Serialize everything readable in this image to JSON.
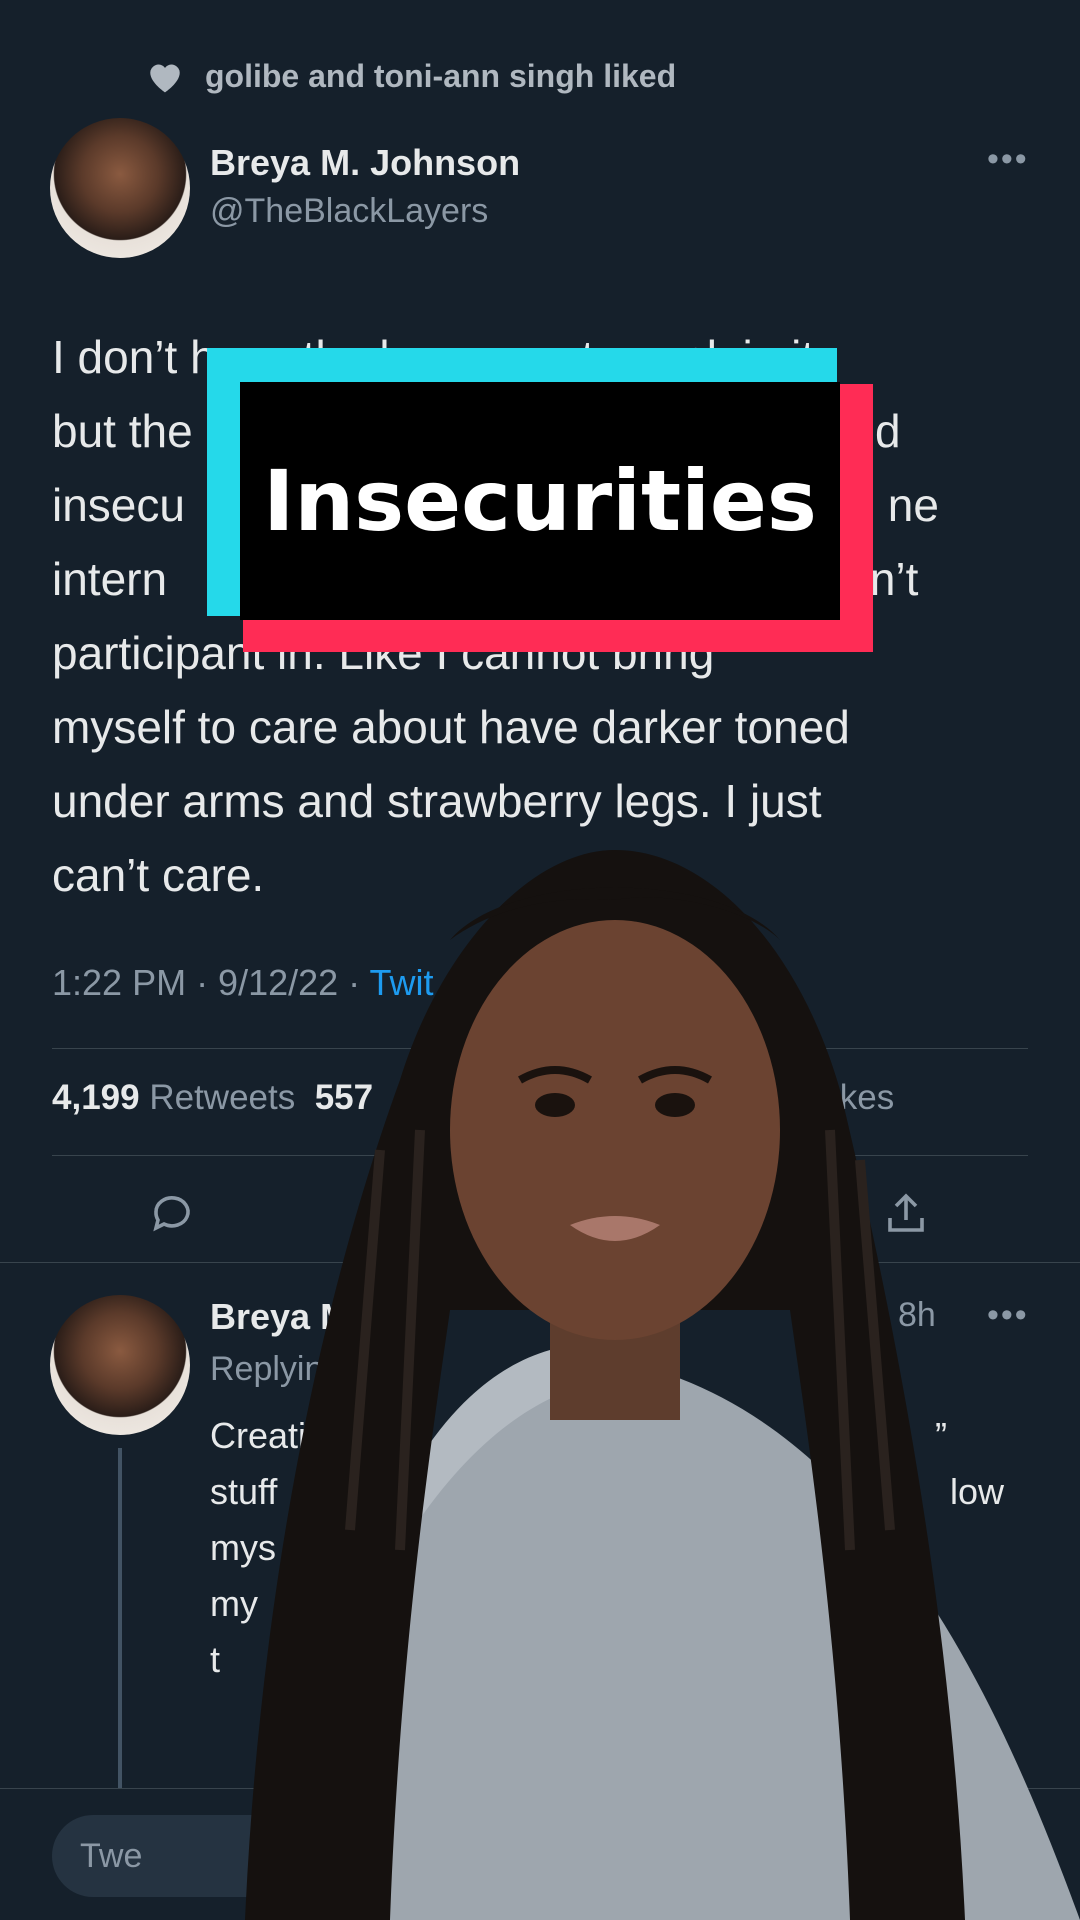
{
  "social_context": {
    "text": "golibe and toni-ann singh liked"
  },
  "tweet": {
    "author_name": "Breya M. Johnson",
    "author_handle": "@TheBlackLayers",
    "more_label": "•••",
    "text": "I don’t have the language to explain it\nbut the               nd\ninsecu                ne\nintern                n’t\nparticipant in. Like I cannot bring\nmyself to care about have darker toned\nunder arms and strawberry legs. I just\ncan’t care.",
    "meta": "1:22 PM · 9/12/22 · ",
    "source": "Twit",
    "retweets_count": "4,199",
    "retweets_label": "Retweets",
    "quotes_count": "557",
    "likes_label": "ikes"
  },
  "reply": {
    "author_name": "Breya M.",
    "time": "8h",
    "more_label": "•••",
    "replying_to": "Replying",
    "line1": "Creatir",
    "line1_end": "”",
    "line2": "stuff",
    "line2_end": "low",
    "line3": "mys",
    "line4": "my",
    "line5": "t"
  },
  "compose": {
    "placeholder": "Twe"
  },
  "overlay": {
    "caption": "Insecurities"
  },
  "colors": {
    "background": "#15202b",
    "link": "#1d9bf0",
    "caption_cyan": "#25d9ea",
    "caption_red": "#ff2c55"
  },
  "icons": [
    "heart-icon",
    "more-icon",
    "reply-icon",
    "retweet-icon",
    "share-icon"
  ]
}
